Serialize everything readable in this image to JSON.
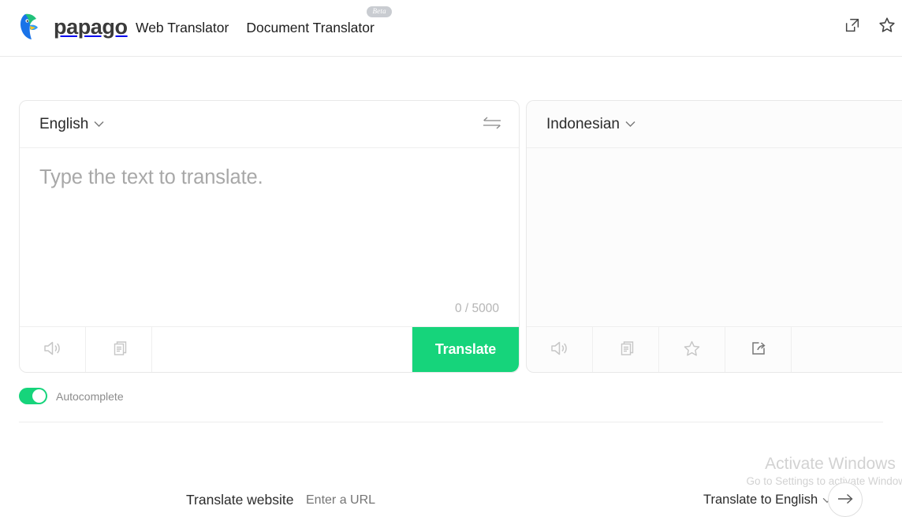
{
  "header": {
    "brand_name": "papago",
    "logo_icon": "papago-parrot-logo",
    "nav": [
      {
        "label": "Web Translator",
        "badge": null
      },
      {
        "label": "Document Translator",
        "badge": "Beta"
      }
    ],
    "actions": [
      {
        "icon": "open-in-new-window-icon",
        "label": "Open in new window"
      },
      {
        "icon": "star-icon",
        "label": "Favorite"
      }
    ]
  },
  "translator": {
    "source": {
      "language": "English",
      "dropdown_icon": "chevron-down-icon",
      "placeholder": "Type the text to translate.",
      "value": "",
      "char_count": "0 / 5000",
      "tools": [
        {
          "icon": "speaker-icon",
          "label": "Listen"
        },
        {
          "icon": "copy-icon",
          "label": "Copy"
        }
      ],
      "translate_label": "Translate"
    },
    "swap_icon": "swap-languages-icon",
    "target": {
      "language": "Indonesian",
      "dropdown_icon": "chevron-down-icon",
      "value": "",
      "tools": [
        {
          "icon": "speaker-icon",
          "label": "Listen"
        },
        {
          "icon": "copy-icon",
          "label": "Copy"
        },
        {
          "icon": "star-icon",
          "label": "Favorite"
        },
        {
          "icon": "share-icon",
          "label": "Share"
        }
      ]
    }
  },
  "autocomplete": {
    "label": "Autocomplete",
    "enabled": true
  },
  "watermark": {
    "title": "Activate Windows",
    "subtitle": "Go to Settings to activate Windows."
  },
  "bottom_bar": {
    "website_label": "Translate website",
    "url_placeholder": "Enter a URL",
    "url_value": "",
    "target_label": "Translate to English",
    "dropdown_icon": "chevron-down-icon",
    "go_icon": "arrow-right-icon"
  },
  "colors": {
    "accent_green": "#16d47b",
    "text_primary": "#2b2b2b",
    "text_muted": "#a8a8a8",
    "border": "#e8e8e8"
  }
}
